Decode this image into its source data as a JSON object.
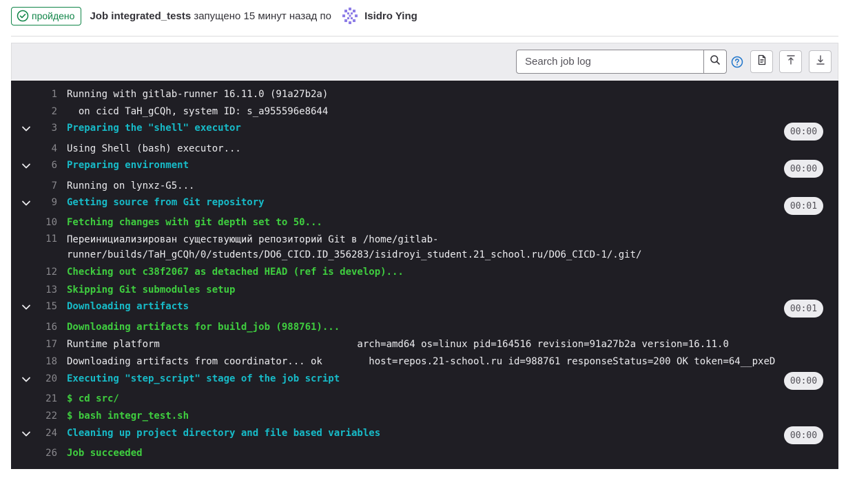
{
  "header": {
    "status": "пройдено",
    "job_name": "Job integrated_tests",
    "started_text": " запущено 15 минут назад по ",
    "user": "Isidro Ying"
  },
  "toolbar": {
    "search_placeholder": "Search job log",
    "icons": [
      "search-icon",
      "help-icon",
      "raw-log-icon",
      "scroll-to-top-icon",
      "scroll-to-bottom-icon"
    ]
  },
  "colors": {
    "success": "#108548",
    "section": "#17bbc8",
    "ok": "#3fce3f",
    "log_bg": "#1f1e24",
    "help": "#1f75cb"
  },
  "log": {
    "l1": {
      "num": "1",
      "text": "Running with gitlab-runner 16.11.0 (91a27b2a)"
    },
    "l2": {
      "num": "2",
      "text": "  on cicd TaH_gCQh, system ID: s_a955596e8644"
    },
    "l3": {
      "num": "3",
      "text": "Preparing the \"shell\" executor",
      "duration": "00:00"
    },
    "l4": {
      "num": "4",
      "text": "Using Shell (bash) executor..."
    },
    "l6": {
      "num": "6",
      "text": "Preparing environment",
      "duration": "00:00"
    },
    "l7": {
      "num": "7",
      "text": "Running on lynxz-G5..."
    },
    "l9": {
      "num": "9",
      "text": "Getting source from Git repository",
      "duration": "00:01"
    },
    "l10": {
      "num": "10",
      "text": "Fetching changes with git depth set to 50..."
    },
    "l11": {
      "num": "11",
      "text": "Переинициализирован существующий репозиторий Git в /home/gitlab-runner/builds/TaH_gCQh/0/students/DO6_CICD.ID_356283/isidroyi_student.21_school.ru/DO6_CICD-1/.git/"
    },
    "l12": {
      "num": "12",
      "text": "Checking out c38f2067 as detached HEAD (ref is develop)..."
    },
    "l13": {
      "num": "13",
      "text": "Skipping Git submodules setup"
    },
    "l15": {
      "num": "15",
      "text": "Downloading artifacts",
      "duration": "00:01"
    },
    "l16": {
      "num": "16",
      "text": "Downloading artifacts for build_job (988761)..."
    },
    "l17": {
      "num": "17",
      "text": "Runtime platform                                  arch=amd64 os=linux pid=164516 revision=91a27b2a version=16.11.0"
    },
    "l18": {
      "num": "18",
      "text": "Downloading artifacts from coordinator... ok        host=repos.21-school.ru id=988761 responseStatus=200 OK token=64__pxeD"
    },
    "l20": {
      "num": "20",
      "text": "Executing \"step_script\" stage of the job script",
      "duration": "00:00"
    },
    "l21": {
      "num": "21",
      "text": "$ cd src/"
    },
    "l22": {
      "num": "22",
      "text": "$ bash integr_test.sh"
    },
    "l24": {
      "num": "24",
      "text": "Cleaning up project directory and file based variables",
      "duration": "00:00"
    },
    "l26": {
      "num": "26",
      "text": "Job succeeded"
    }
  }
}
